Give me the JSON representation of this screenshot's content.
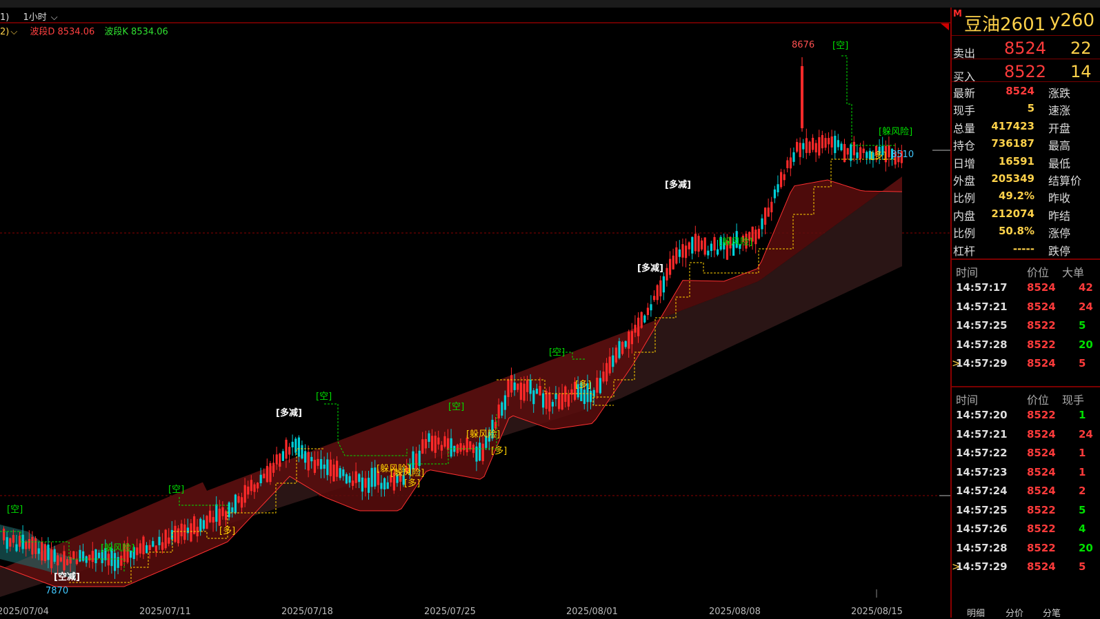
{
  "toolbar": {
    "prefix": "1)",
    "period": "1小时"
  },
  "indicator": {
    "prefix": "2)",
    "d_label": "波段D 8534.06",
    "k_label": "波段K 8534.06"
  },
  "colors": {
    "up": "#ff2a2a",
    "down": "#00d0d8",
    "signal_green": "#00e000",
    "signal_yellow": "#ffd000",
    "band": "#5a0a0a"
  },
  "chart_data": {
    "type": "candlestick",
    "x_tick_labels": [
      "2025/07/04",
      "2025/07/11",
      "2025/07/18",
      "2025/07/25",
      "2025/08/01",
      "2025/08/08",
      "2025/08/15"
    ],
    "high_label": "8676",
    "low_label": "7870",
    "last_label": "8510",
    "signals": [
      {
        "text": "[空]",
        "color": "green"
      },
      {
        "text": "[空减]",
        "color": "white"
      },
      {
        "text": "[躲风险]",
        "color": "green"
      },
      {
        "text": "[空]",
        "color": "green"
      },
      {
        "text": "[多]",
        "color": "yellow"
      },
      {
        "text": "[多减]",
        "color": "white"
      },
      {
        "text": "[空]",
        "color": "green"
      },
      {
        "text": "[躲风险]",
        "color": "yellow"
      },
      {
        "text": "[躲风险]",
        "color": "yellow"
      },
      {
        "text": "[多]",
        "color": "yellow"
      },
      {
        "text": "[空]",
        "color": "green"
      },
      {
        "text": "[躲风险]",
        "color": "yellow"
      },
      {
        "text": "[多]",
        "color": "yellow"
      },
      {
        "text": "[空]",
        "color": "green"
      },
      {
        "text": "[多]",
        "color": "yellow"
      },
      {
        "text": "[多减]",
        "color": "white"
      },
      {
        "text": "[多减]",
        "color": "white"
      },
      {
        "text": "[躲风险]",
        "color": "green"
      },
      {
        "text": "[空]",
        "color": "green"
      },
      {
        "text": "[躲风险]",
        "color": "green"
      },
      {
        "text": "[多]",
        "color": "yellow"
      }
    ]
  },
  "quote": {
    "marker": "M",
    "name": "豆油2601",
    "code": "y260",
    "sell_label": "卖出",
    "sell_price": "8524",
    "sell_vol": "22",
    "buy_label": "买入",
    "buy_price": "8522",
    "buy_vol": "14",
    "rows": [
      {
        "label": "最新",
        "value": "8524",
        "label2": "涨跌",
        "color": "#ff3b3b"
      },
      {
        "label": "现手",
        "value": "5",
        "label2": "速涨",
        "color": "#ffd24a"
      },
      {
        "label": "总量",
        "value": "417423",
        "label2": "开盘",
        "color": "#ffd24a"
      },
      {
        "label": "持仓",
        "value": "736187",
        "label2": "最高",
        "color": "#ffd24a"
      },
      {
        "label": "日增",
        "value": "16591",
        "label2": "最低",
        "color": "#ffd24a"
      },
      {
        "label": "外盘",
        "value": "205349",
        "label2": "结算价",
        "color": "#ffd24a"
      },
      {
        "label": "比例",
        "value": "49.2%",
        "label2": "昨收",
        "color": "#ffd24a"
      },
      {
        "label": "内盘",
        "value": "212074",
        "label2": "昨结",
        "color": "#ffd24a"
      },
      {
        "label": "比例",
        "value": "50.8%",
        "label2": "涨停",
        "color": "#ffd24a"
      },
      {
        "label": "杠杆",
        "value": "-----",
        "label2": "跌停",
        "color": "#ffd24a"
      }
    ]
  },
  "ticks1": {
    "headers": [
      "时间",
      "价位",
      "大单"
    ],
    "rows": [
      {
        "time": "14:57:17",
        "price": "8524",
        "qty": "42",
        "qcolor": "#ff3b3b",
        "marked": false
      },
      {
        "time": "14:57:21",
        "price": "8524",
        "qty": "24",
        "qcolor": "#ff3b3b",
        "marked": false
      },
      {
        "time": "14:57:25",
        "price": "8522",
        "qty": "5",
        "qcolor": "#00e000",
        "marked": false
      },
      {
        "time": "14:57:28",
        "price": "8522",
        "qty": "20",
        "qcolor": "#00e000",
        "marked": false
      },
      {
        "time": "14:57:29",
        "price": "8524",
        "qty": "5",
        "qcolor": "#ff3b3b",
        "marked": true
      }
    ]
  },
  "ticks2": {
    "headers": [
      "时间",
      "价位",
      "现手"
    ],
    "rows": [
      {
        "time": "14:57:20",
        "price": "8522",
        "qty": "1",
        "qcolor": "#00e000",
        "marked": false
      },
      {
        "time": "14:57:21",
        "price": "8524",
        "qty": "24",
        "qcolor": "#ff3b3b",
        "marked": false
      },
      {
        "time": "14:57:22",
        "price": "8524",
        "qty": "1",
        "qcolor": "#ff3b3b",
        "marked": false
      },
      {
        "time": "14:57:23",
        "price": "8524",
        "qty": "1",
        "qcolor": "#ff3b3b",
        "marked": false
      },
      {
        "time": "14:57:24",
        "price": "8524",
        "qty": "2",
        "qcolor": "#ff3b3b",
        "marked": false
      },
      {
        "time": "14:57:25",
        "price": "8522",
        "qty": "5",
        "qcolor": "#00e000",
        "marked": false
      },
      {
        "time": "14:57:26",
        "price": "8522",
        "qty": "4",
        "qcolor": "#00e000",
        "marked": false
      },
      {
        "time": "14:57:28",
        "price": "8522",
        "qty": "20",
        "qcolor": "#00e000",
        "marked": false
      },
      {
        "time": "14:57:29",
        "price": "8524",
        "qty": "5",
        "qcolor": "#ff3b3b",
        "marked": true
      }
    ]
  },
  "bottom_tabs": [
    "明细",
    "分价",
    "分笔"
  ]
}
